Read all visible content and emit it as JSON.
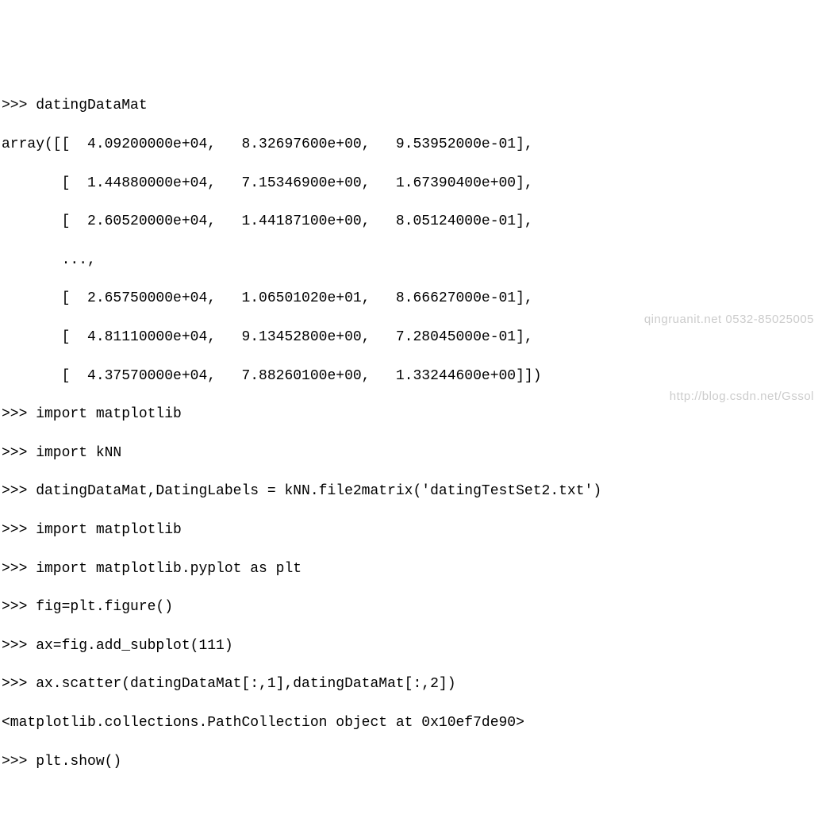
{
  "lines": {
    "l0": ">>> datingDataMat",
    "l1": "array([[  4.09200000e+04,   8.32697600e+00,   9.53952000e-01],",
    "l2": "       [  1.44880000e+04,   7.15346900e+00,   1.67390400e+00],",
    "l3": "       [  2.60520000e+04,   1.44187100e+00,   8.05124000e-01],",
    "l4": "       ..., ",
    "l5": "       [  2.65750000e+04,   1.06501020e+01,   8.66627000e-01],",
    "l6": "       [  4.81110000e+04,   9.13452800e+00,   7.28045000e-01],",
    "l7": "       [  4.37570000e+04,   7.88260100e+00,   1.33244600e+00]])",
    "l8": ">>> import matplotlib",
    "l9": ">>> import kNN",
    "l10": ">>> datingDataMat,DatingLabels = kNN.file2matrix('datingTestSet2.txt')",
    "l11": ">>> import matplotlib",
    "l12": ">>> import matplotlib.pyplot as plt",
    "l13": ">>> fig=plt.figure()",
    "l14": ">>> ax=fig.add_subplot(111)",
    "l15": ">>> ax.scatter(datingDataMat[:,1],datingDataMat[:,2])",
    "l16": "<matplotlib.collections.PathCollection object at 0x10ef7de90>",
    "l17": ">>> plt.show()"
  },
  "watermarks": {
    "w1": "qingruanit.net 0532-85025005",
    "w2": "http://blog.csdn.net/Gssol"
  }
}
